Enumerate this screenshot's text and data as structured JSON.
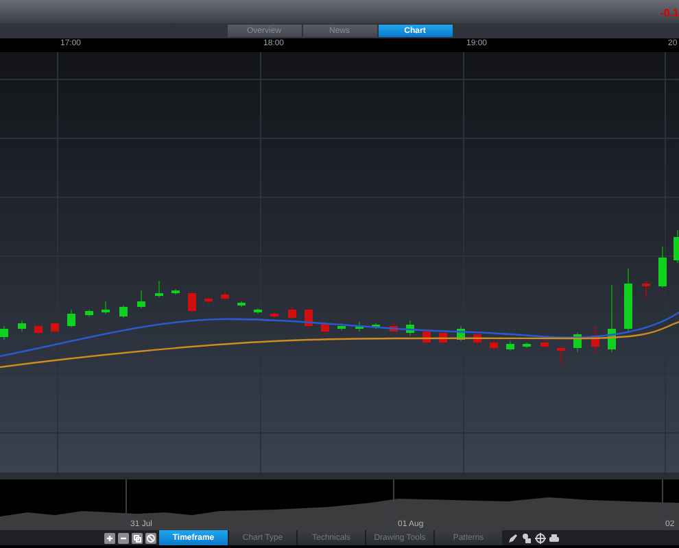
{
  "header": {
    "change": "-0.1"
  },
  "view_tabs": [
    {
      "label": "Overview",
      "selected": false
    },
    {
      "label": "News",
      "selected": false
    },
    {
      "label": "Chart",
      "selected": true
    }
  ],
  "time_axis": [
    "17:00",
    "18:00",
    "19:00",
    "20"
  ],
  "overview_axis": [
    "31 Jul",
    "01 Aug",
    "02"
  ],
  "toolbar_tabs": [
    {
      "label": "Timeframe",
      "selected": true
    },
    {
      "label": "Chart Type",
      "selected": false
    },
    {
      "label": "Technicals",
      "selected": false
    },
    {
      "label": "Drawing Tools",
      "selected": false
    },
    {
      "label": "Patterns",
      "selected": false
    }
  ]
}
